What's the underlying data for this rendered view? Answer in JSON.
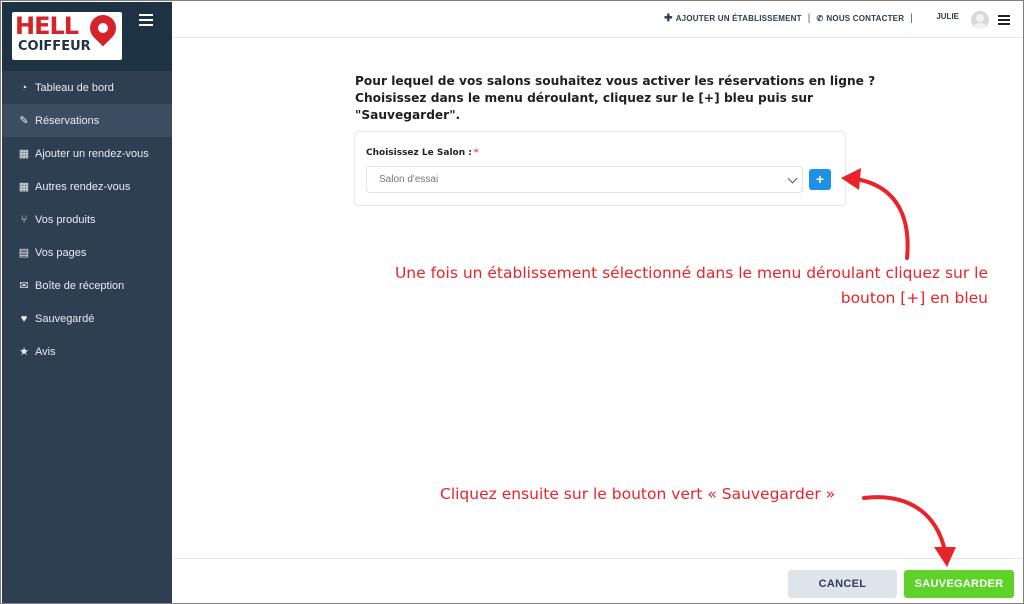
{
  "brand": {
    "logo_hello": "HELL",
    "logo_coiffeur": "COIFFEUR",
    "accent_color": "#d6222a",
    "sidebar_bg": "#2f3f52"
  },
  "sidebar": {
    "items": [
      {
        "label": "Tableau de bord",
        "icon": "dashboard-icon",
        "glyph": "◔",
        "active": false
      },
      {
        "label": "Réservations",
        "icon": "edit-icon",
        "glyph": "✎",
        "active": true
      },
      {
        "label": "Ajouter un rendez-vous",
        "icon": "calendar-icon",
        "glyph": "▦",
        "active": false
      },
      {
        "label": "Autres rendez-vous",
        "icon": "calendar-icon",
        "glyph": "▦",
        "active": false
      },
      {
        "label": "Vos produits",
        "icon": "utensils-icon",
        "glyph": "⑂",
        "active": false
      },
      {
        "label": "Vos pages",
        "icon": "id-card-icon",
        "glyph": "▤",
        "active": false
      },
      {
        "label": "Boîte de réception",
        "icon": "envelope-icon",
        "glyph": "✉",
        "active": false
      },
      {
        "label": "Sauvegardé",
        "icon": "heart-icon",
        "glyph": "♥",
        "active": false
      },
      {
        "label": "Avis",
        "icon": "star-icon",
        "glyph": "★",
        "active": false
      }
    ]
  },
  "topbar": {
    "add_establishment": "AJOUTER UN ÉTABLISSEMENT",
    "contact": "NOUS CONTACTER",
    "user_name": "JULIE"
  },
  "main": {
    "intro_lines": [
      "Pour lequel de vos salons souhaitez vous activer les réservations en ligne ?",
      "Choisissez dans le menu déroulant, cliquez sur le [+] bleu puis sur",
      "\"Sauvegarder\"."
    ],
    "field_label": "Choisissez Le Salon :",
    "required_mark": "*",
    "select_value": "Salon d'essai",
    "plus_label": "+"
  },
  "annotations": {
    "arrow_color": "#e8242a",
    "note_1_lines": [
      "Une fois un établissement sélectionné dans le menu déroulant cliquez sur le",
      "bouton [+] en bleu"
    ],
    "note_2": "Cliquez ensuite sur le bouton vert « Sauvegarder »"
  },
  "footer": {
    "cancel_label": "CANCEL",
    "save_label": "SAUVEGARDER",
    "save_color": "#5fd22a"
  }
}
